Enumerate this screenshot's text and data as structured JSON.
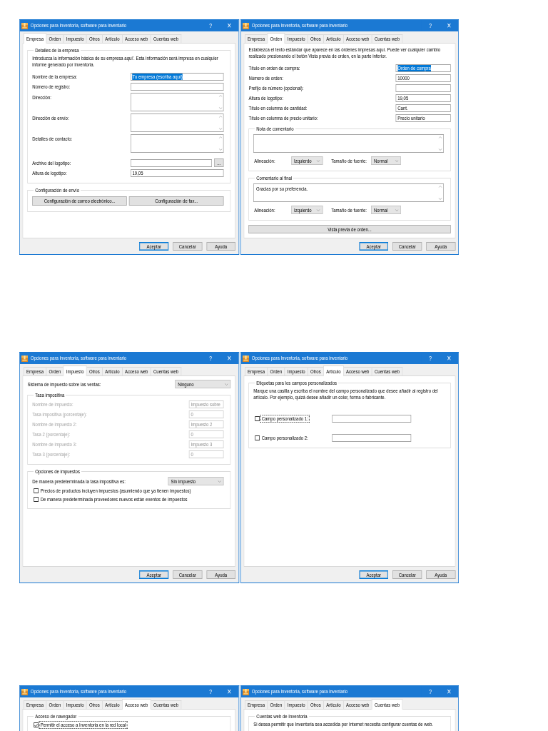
{
  "dialogs": [
    {
      "title": "Opciones para Inventoria, software para inventario",
      "help": "?",
      "close": "×",
      "tabs": [
        {
          "label": "Empresa",
          "selected": true
        },
        {
          "label": "Orden",
          "selected": false
        },
        {
          "label": "Impuesto",
          "selected": false
        },
        {
          "label": "Otros",
          "selected": false
        },
        {
          "label": "Artículo",
          "selected": false
        },
        {
          "label": "Acceso web",
          "selected": false
        },
        {
          "label": "Cuentas web",
          "selected": false
        }
      ],
      "content": [
        {
          "kind": "group",
          "legend": "Detalles de la empresa",
          "disabled": false,
          "items": [
            {
              "kind": "paragraph",
              "text": "Introduzca la información básica de su empresa aquí'. Esta información será impresa en cualquier informe generado por Inventoria."
            },
            {
              "kind": "field",
              "label": "Nombre de la empresa:",
              "value": "Tu empresa (escriba aquí)",
              "text_selected": true
            },
            {
              "kind": "field",
              "label": "Número de registro:"
            },
            {
              "kind": "textarea",
              "label": "Dirección:"
            },
            {
              "kind": "textarea",
              "label": "Dirección de envío:"
            },
            {
              "kind": "textarea",
              "label": "Detalles de contacto:"
            },
            {
              "kind": "file",
              "label": "Archivo del logotipo:",
              "button": "..."
            },
            {
              "kind": "field",
              "label": "Altura de logotipo:",
              "value": "19,05",
              "text_selected": false
            }
          ]
        },
        {
          "kind": "group",
          "legend": "Configuración de envío",
          "disabled": false,
          "items": [
            {
              "kind": "buttons",
              "buttons": [
                "Configuración de correo electrónico...",
                "Configuración de fax..."
              ]
            }
          ]
        }
      ],
      "buttons": [
        {
          "label": "Aceptar",
          "default": true
        },
        {
          "label": "Cancelar",
          "default": false
        },
        {
          "label": "Ayuda",
          "default": false
        }
      ]
    },
    {
      "title": "Opciones para Inventoria, software para inventario",
      "help": "?",
      "close": "×",
      "tabs": [
        {
          "label": "Empresa",
          "selected": false
        },
        {
          "label": "Orden",
          "selected": true
        },
        {
          "label": "Impuesto",
          "selected": false
        },
        {
          "label": "Otros",
          "selected": false
        },
        {
          "label": "Artículo",
          "selected": false
        },
        {
          "label": "Acceso web",
          "selected": false
        },
        {
          "label": "Cuentas web",
          "selected": false
        }
      ],
      "content": [
        {
          "kind": "paragraph",
          "text": "Establezca el texto estándar que aparece en las órdenes impresas aquí. Puede ver cualquier cambio realizado presionando el botón Vista previa de orden, en la parte inferior."
        },
        {
          "kind": "field",
          "label": "Título en orden de compra:",
          "value": "Orden de compra",
          "text_selected": true
        },
        {
          "kind": "field",
          "label": "Número de orden:",
          "value": "10000",
          "text_selected": false
        },
        {
          "kind": "field",
          "label": "Prefijo de número (opcional):"
        },
        {
          "kind": "field",
          "label": "Altura de logotipo:",
          "value": "19,05",
          "text_selected": false
        },
        {
          "kind": "field",
          "label": "Título en columna de cantidad:",
          "value": "Cant.",
          "text_selected": false
        },
        {
          "kind": "field",
          "label": "Título en columna de precio unitario:",
          "value": "Precio unitario",
          "text_selected": false
        },
        {
          "kind": "group",
          "legend": "Nota de comentario",
          "disabled": false,
          "items": [
            {
              "kind": "textarea"
            },
            {
              "kind": "select_row",
              "selects": [
                {
                  "label": "Alineación:",
                  "value": "Izquierdo"
                },
                {
                  "label": "Tamaño de fuente:",
                  "value": "Normal"
                }
              ]
            }
          ]
        },
        {
          "kind": "group",
          "legend": "Comentario al final",
          "disabled": false,
          "items": [
            {
              "kind": "textarea",
              "value": "Gracias por su preferencia."
            },
            {
              "kind": "select_row",
              "selects": [
                {
                  "label": "Alineación:",
                  "value": "Izquierdo"
                },
                {
                  "label": "Tamaño de fuente:",
                  "value": "Normal"
                }
              ]
            }
          ]
        },
        {
          "kind": "button",
          "label": "Vista previa de orden..."
        }
      ],
      "buttons": [
        {
          "label": "Aceptar",
          "default": true
        },
        {
          "label": "Cancelar",
          "default": false
        },
        {
          "label": "Ayuda",
          "default": false
        }
      ]
    },
    {
      "title": "Opciones para Inventoria, software para inventario",
      "help": "?",
      "close": "×",
      "tabs": [
        {
          "label": "Empresa",
          "selected": false
        },
        {
          "label": "Orden",
          "selected": false
        },
        {
          "label": "Impuesto",
          "selected": true
        },
        {
          "label": "Otros",
          "selected": false
        },
        {
          "label": "Artículo",
          "selected": false
        },
        {
          "label": "Acceso web",
          "selected": false
        },
        {
          "label": "Cuentas web",
          "selected": false
        }
      ],
      "content": [
        {
          "kind": "select",
          "label": "Sistema de impuesto sobre las ventas:",
          "value": "Ninguno"
        },
        {
          "kind": "group",
          "legend": "Tasa impositiva",
          "disabled": true,
          "items": [
            {
              "kind": "field",
              "label": "Nombre de impuesto:",
              "value": "Impuesto sobre",
              "text_selected": false
            },
            {
              "kind": "field",
              "label": "Tasa impositiva (porcentaje):",
              "value": "0",
              "text_selected": false
            },
            {
              "kind": "field",
              "label": "Nombre de impuesto 2:",
              "value": "Impuesto 2",
              "text_selected": false
            },
            {
              "kind": "field",
              "label": "Tasa 2 (porcentaje):",
              "value": "0",
              "text_selected": false
            },
            {
              "kind": "field",
              "label": "Nombre de impuesto 3:",
              "value": "Impuesto 3",
              "text_selected": false
            },
            {
              "kind": "field",
              "label": "Tasa 3 (porcentaje):",
              "value": "0",
              "text_selected": false
            }
          ]
        },
        {
          "kind": "group",
          "legend": "Opciones de impuestos",
          "disabled": false,
          "items": [
            {
              "kind": "select",
              "label": "De manera predeterminada la tasa impositiva es:",
              "value": "Sin impuesto"
            },
            {
              "kind": "checkbox",
              "label": "Precios de productos incluyen impuestos (asumiendo que ya tienen impuestos)",
              "checked": false,
              "focused": false
            },
            {
              "kind": "checkbox",
              "label": "De manera predeterminada proveedores nuevos están exentos de impuestos",
              "checked": false,
              "focused": false
            }
          ]
        }
      ],
      "buttons": [
        {
          "label": "Aceptar",
          "default": true
        },
        {
          "label": "Cancelar",
          "default": false
        },
        {
          "label": "Ayuda",
          "default": false
        }
      ]
    },
    {
      "title": "Opciones para Inventoria, software para inventario",
      "help": "?",
      "close": "×",
      "tabs": [
        {
          "label": "Empresa",
          "selected": false
        },
        {
          "label": "Orden",
          "selected": false
        },
        {
          "label": "Impuesto",
          "selected": false
        },
        {
          "label": "Otros",
          "selected": false
        },
        {
          "label": "Artículo",
          "selected": true
        },
        {
          "label": "Acceso web",
          "selected": false
        },
        {
          "label": "Cuentas web",
          "selected": false
        }
      ],
      "content": [
        {
          "kind": "group",
          "legend": "Etiquetas para los campos personalizados",
          "disabled": false,
          "items": [
            {
              "kind": "paragraph",
              "text": "Marque una casilla y escriba el nombre del campo personalizado que desee añadir al registro del artículo. Por ejemplo, quizá desee añadir un color, forma o fabricante."
            },
            {
              "kind": "checkbox_field",
              "label": "Campo personalizado 1:",
              "checked": false,
              "focused": true
            },
            {
              "kind": "checkbox_field",
              "label": "Campo personalizado 2:",
              "checked": false,
              "focused": false
            }
          ]
        }
      ],
      "buttons": [
        {
          "label": "Aceptar",
          "default": true
        },
        {
          "label": "Cancelar",
          "default": false
        },
        {
          "label": "Ayuda",
          "default": false
        }
      ]
    },
    {
      "title": "Opciones para Inventoria, software para inventario",
      "help": "?",
      "close": "×",
      "tabs": [
        {
          "label": "Empresa",
          "selected": false
        },
        {
          "label": "Orden",
          "selected": false
        },
        {
          "label": "Impuesto",
          "selected": false
        },
        {
          "label": "Otros",
          "selected": false
        },
        {
          "label": "Artículo",
          "selected": false
        },
        {
          "label": "Acceso web",
          "selected": true
        },
        {
          "label": "Cuentas web",
          "selected": false
        }
      ],
      "content": [
        {
          "kind": "group",
          "legend": "Acceso de navegador",
          "disabled": false,
          "items": [
            {
              "kind": "checkbox",
              "label": "Permitir el acceso a Inventoria en la red local",
              "checked": true,
              "focused": true
            }
          ]
        }
      ]
    },
    {
      "title": "Opciones para Inventoria, software para inventario",
      "help": "?",
      "close": "×",
      "tabs": [
        {
          "label": "Empresa",
          "selected": false
        },
        {
          "label": "Orden",
          "selected": false
        },
        {
          "label": "Impuesto",
          "selected": false
        },
        {
          "label": "Otros",
          "selected": false
        },
        {
          "label": "Artículo",
          "selected": false
        },
        {
          "label": "Acceso web",
          "selected": false
        },
        {
          "label": "Cuentas web",
          "selected": true
        }
      ],
      "content": [
        {
          "kind": "group",
          "legend": "Cuentas web de Inventoria",
          "disabled": false,
          "items": [
            {
              "kind": "paragraph",
              "text": "Si desea permitir que Inventoria sea accedida por Internet necesita configurar cuentas de web."
            }
          ]
        }
      ]
    }
  ]
}
